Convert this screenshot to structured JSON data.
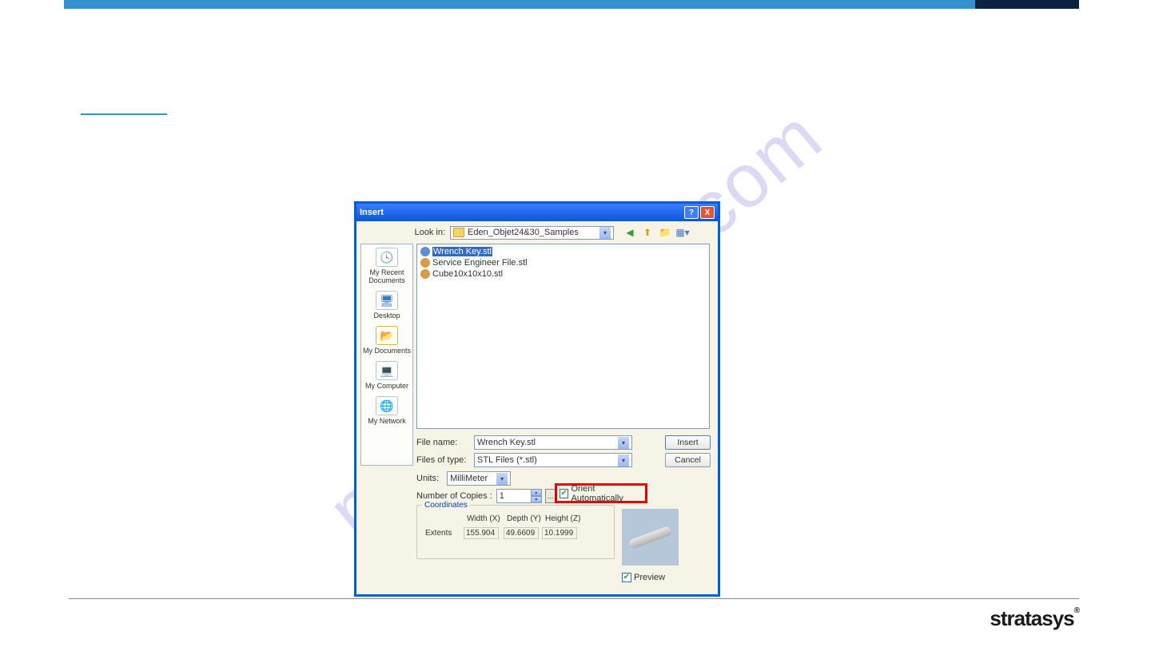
{
  "dialog": {
    "title": "Insert",
    "look_in_label": "Look in:",
    "look_in_value": "Eden_Objet24&30_Samples",
    "places": {
      "recent": "My Recent Documents",
      "desktop": "Desktop",
      "mydocs": "My Documents",
      "mycomp": "My Computer",
      "mynet": "My Network"
    },
    "files": [
      {
        "name": "Wrench Key.stl",
        "selected": true,
        "color": "blue"
      },
      {
        "name": "Service Engineer File.stl",
        "selected": false,
        "color": "org"
      },
      {
        "name": "Cube10x10x10.stl",
        "selected": false,
        "color": "org"
      }
    ],
    "filename_label": "File name:",
    "filename_value": "Wrench Key.stl",
    "filetype_label": "Files of type:",
    "filetype_value": "STL Files (*.stl)",
    "insert_btn": "Insert",
    "cancel_btn": "Cancel",
    "units_label": "Units:",
    "units_value": "MilliMeter",
    "copies_label": "Number of Copies :",
    "copies_value": "1",
    "orient_label": "Orient Automatically",
    "coord_title": "Coordinates",
    "extents_label": "Extents",
    "width_label": "Width (X)",
    "depth_label": "Depth (Y)",
    "height_label": "Height (Z)",
    "width_val": "155.904",
    "depth_val": "49.6609",
    "height_val": "10.1999",
    "preview_label": "Preview"
  },
  "watermark": "manualshive.com",
  "logo": "stratasys"
}
